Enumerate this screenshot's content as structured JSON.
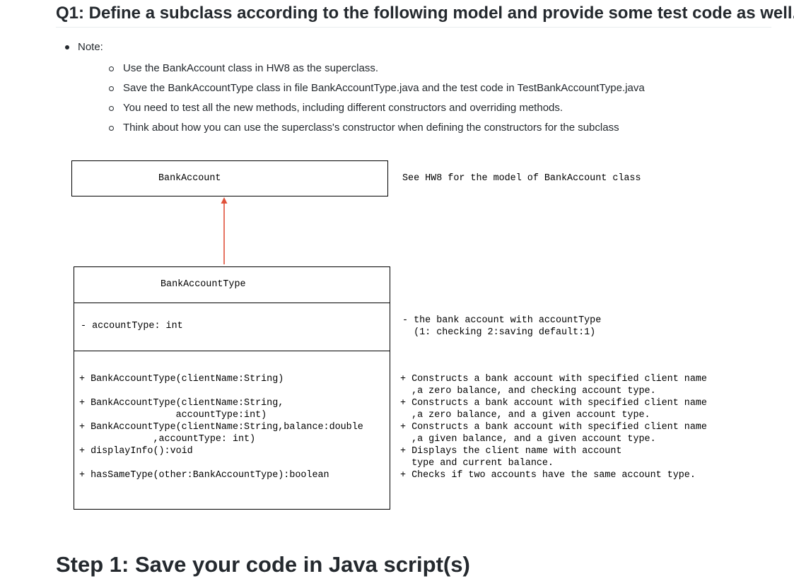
{
  "question": {
    "title": "Q1: Define a subclass according to the following model and provide some test code as well."
  },
  "notes": {
    "label": "Note:",
    "items": [
      "Use the BankAccount class in HW8 as the superclass.",
      "Save the BankAccountType class in file BankAccountType.java and the test code in TestBankAccountType.java",
      "You need to test all the new methods, including different constructors and overriding methods.",
      "Think about how you can use the superclass's constructor when defining the constructors for the subclass"
    ]
  },
  "diagram": {
    "superclass": {
      "name": "BankAccount",
      "description": "See HW8 for the model of BankAccount class"
    },
    "subclass": {
      "name": "BankAccountType",
      "field": "- accountType: int",
      "field_description": [
        "- the bank account with accountType",
        "  (1: checking 2:saving default:1)"
      ],
      "methods": [
        "+ BankAccountType(clientName:String)",
        "+ BankAccountType(clientName:String,",
        "                 accountType:int)",
        "+ BankAccountType(clientName:String,balance:double",
        "             ,accountType: int)",
        "+ displayInfo():void",
        "+ hasSameType(other:BankAccountType):boolean"
      ],
      "method_descriptions": [
        "+ Constructs a bank account with specified client name",
        "  ,a zero balance, and checking account type.",
        "+ Constructs a bank account with specified client name",
        "  ,a zero balance, and a given account type.",
        "+ Constructs a bank account with specified client name",
        "  ,a given balance, and a given account type.",
        "+ Displays the client name with account",
        "  type and current balance.",
        "+ Checks if two accounts have the same account type."
      ]
    },
    "arrow_color": "#e0513a"
  },
  "step": {
    "title": "Step 1: Save your code in Java script(s)"
  }
}
